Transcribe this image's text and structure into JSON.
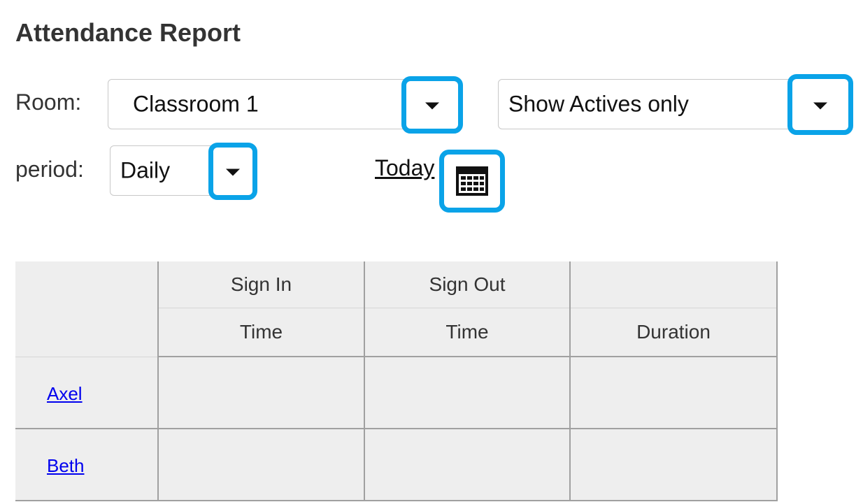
{
  "page": {
    "title": "Attendance Report"
  },
  "filters": {
    "room_label": "Room:",
    "room_value": "Classroom 1",
    "status_value": "Show Actives only",
    "period_label": "period:",
    "period_value": "Daily",
    "date_link": "Today"
  },
  "icons": {
    "dropdown": "caret-down-icon",
    "calendar": "calendar-icon"
  },
  "colors": {
    "highlight": "#0aa3e8",
    "link": "#0000ee",
    "table_bg": "#eeeeee"
  },
  "table": {
    "group_headers": [
      "Sign In",
      "Sign Out",
      ""
    ],
    "column_headers": [
      "Time",
      "Time",
      "Duration"
    ],
    "rows": [
      {
        "name": "Axel",
        "sign_in": "",
        "sign_out": "",
        "duration": ""
      },
      {
        "name": "Beth",
        "sign_in": "",
        "sign_out": "",
        "duration": ""
      }
    ]
  }
}
